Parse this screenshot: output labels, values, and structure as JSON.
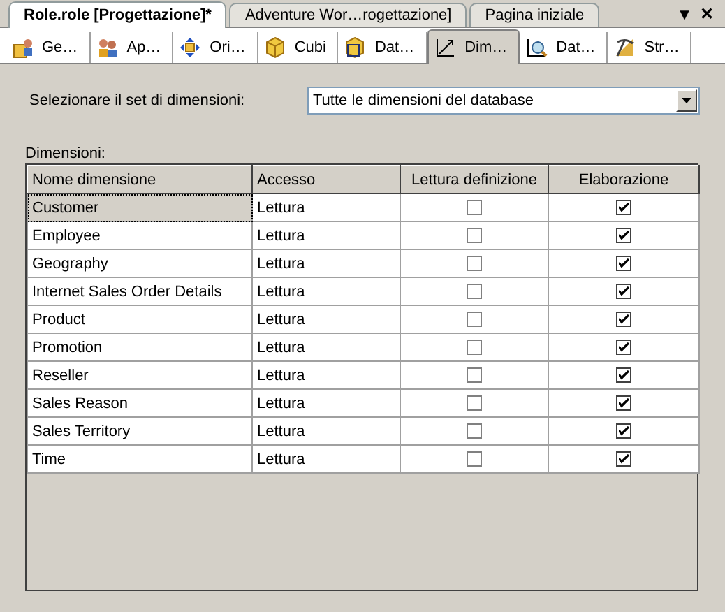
{
  "document_tabs": [
    {
      "label": "Role.role [Progettazione]*",
      "selected": true
    },
    {
      "label": "Adventure Wor…rogettazione]",
      "selected": false
    },
    {
      "label": "Pagina iniziale",
      "selected": false
    }
  ],
  "document_controls": {
    "menu": "▾",
    "close": "✕"
  },
  "designer_tabs": [
    {
      "label": "Ge…",
      "kind": "users",
      "selected": false
    },
    {
      "label": "Ap…",
      "kind": "people",
      "selected": false
    },
    {
      "label": "Ori…",
      "kind": "move",
      "selected": false
    },
    {
      "label": "Cubi",
      "kind": "cube",
      "selected": false
    },
    {
      "label": "Dat…",
      "kind": "cubeframe",
      "selected": false
    },
    {
      "label": "Dim…",
      "kind": "axes",
      "selected": true
    },
    {
      "label": "Dat…",
      "kind": "magnify",
      "selected": false
    },
    {
      "label": "Str…",
      "kind": "pick",
      "selected": false
    }
  ],
  "dimension_set": {
    "label": "Selezionare il set di dimensioni:",
    "value": "Tutte le dimensioni del database"
  },
  "dimensions": {
    "label": "Dimensioni:",
    "columns": [
      "Nome dimensione",
      "Accesso",
      "Lettura definizione",
      "Elaborazione"
    ],
    "rows": [
      {
        "name": "Customer",
        "access": "Lettura",
        "read_definition": false,
        "process": true,
        "selected": true
      },
      {
        "name": "Employee",
        "access": "Lettura",
        "read_definition": false,
        "process": true,
        "selected": false
      },
      {
        "name": "Geography",
        "access": "Lettura",
        "read_definition": false,
        "process": true,
        "selected": false
      },
      {
        "name": "Internet Sales Order Details",
        "access": "Lettura",
        "read_definition": false,
        "process": true,
        "selected": false
      },
      {
        "name": "Product",
        "access": "Lettura",
        "read_definition": false,
        "process": true,
        "selected": false
      },
      {
        "name": "Promotion",
        "access": "Lettura",
        "read_definition": false,
        "process": true,
        "selected": false
      },
      {
        "name": "Reseller",
        "access": "Lettura",
        "read_definition": false,
        "process": true,
        "selected": false
      },
      {
        "name": "Sales Reason",
        "access": "Lettura",
        "read_definition": false,
        "process": true,
        "selected": false
      },
      {
        "name": "Sales Territory",
        "access": "Lettura",
        "read_definition": false,
        "process": true,
        "selected": false
      },
      {
        "name": "Time",
        "access": "Lettura",
        "read_definition": false,
        "process": true,
        "selected": false
      }
    ]
  }
}
